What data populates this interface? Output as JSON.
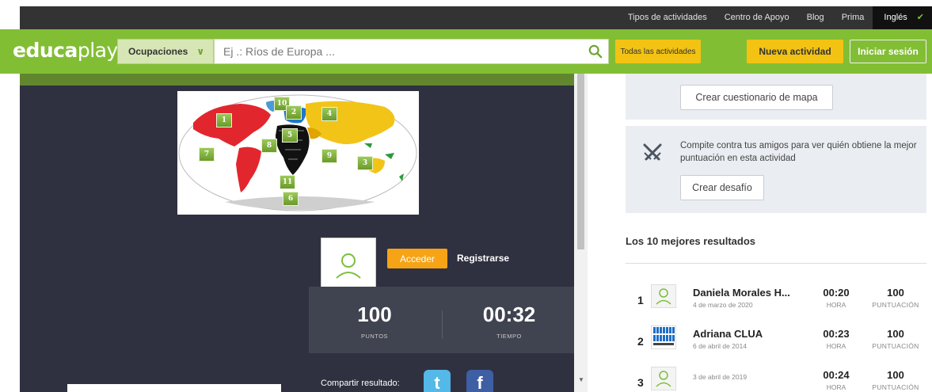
{
  "topnav": {
    "links": [
      "Tipos de actividades",
      "Centro de Apoyo",
      "Blog",
      "Prima"
    ],
    "language": "Inglés"
  },
  "header": {
    "logo_bold": "educa",
    "logo_thin": "play",
    "occupations_label": "Ocupaciones",
    "search_placeholder": "Ej .: Ríos de Europa ...",
    "all_activities": "Todas las actividades",
    "new_activity": "Nueva actividad",
    "login": "Iniciar sesión"
  },
  "game": {
    "map_pins": [
      "10",
      "2",
      "4",
      "1",
      "5",
      "8",
      "7",
      "9",
      "3",
      "11",
      "6"
    ],
    "login_button": "Acceder",
    "register_link": "Registrarse",
    "score_value": "100",
    "score_label": "PUNTOS",
    "time_value": "00:32",
    "time_label": "TIEMPO",
    "share_label": "Compartir resultado:"
  },
  "sidebar": {
    "create_map_quiz": "Crear cuestionario de mapa",
    "challenge_text": "Compite contra tus amigos para ver quién obtiene la mejor puntuación en esta actividad",
    "create_challenge": "Crear desafío",
    "top_results_title": "Los 10 mejores resultados",
    "results": [
      {
        "pos": "1",
        "name": "Daniela Morales H...",
        "date": "4 de marzo de 2020",
        "time": "00:20",
        "time_label": "HORA",
        "score": "100",
        "score_label": "PUNTUACIÓN",
        "avatar": "default"
      },
      {
        "pos": "2",
        "name": "Adriana CLUA",
        "date": "6 de abril de 2014",
        "time": "00:23",
        "time_label": "HORA",
        "score": "100",
        "score_label": "PUNTUACIÓN",
        "avatar": "image"
      },
      {
        "pos": "3",
        "name": "",
        "date": "3 de abril de 2019",
        "time": "00:24",
        "time_label": "HORA",
        "score": "100",
        "score_label": "PUNTUACIÓN",
        "avatar": "default"
      }
    ]
  },
  "colors": {
    "brand_green": "#82be34",
    "accent_yellow": "#f3c314",
    "accent_orange": "#f6a316",
    "panel_dark": "#2f3140"
  }
}
